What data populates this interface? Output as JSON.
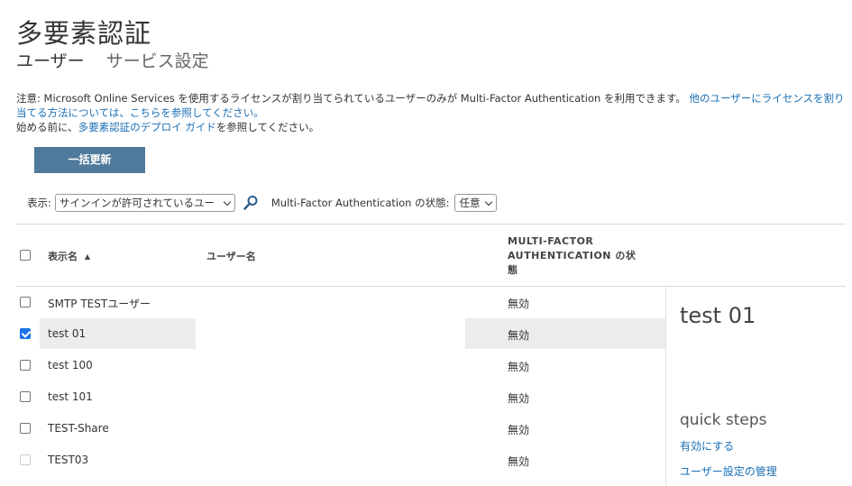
{
  "header": {
    "title": "多要素認証",
    "tabs": [
      {
        "label": "ユーザー",
        "active": true
      },
      {
        "label": "サービス設定",
        "active": false
      }
    ]
  },
  "notice": {
    "line1_text": "注意: Microsoft Online Services を使用するライセンスが割り当てられているユーザーのみが Multi-Factor Authentication を利用できます。",
    "line1_link": "他のユーザーにライセンスを割り当てる方法については、こちらを参照してください。",
    "line2_prefix": "始める前に、",
    "line2_link": "多要素認証のデプロイ ガイド",
    "line2_suffix": "を参照してください。"
  },
  "toolbar": {
    "bulk_update_label": "一括更新"
  },
  "filters": {
    "view_label": "表示:",
    "view_value": "サインインが許可されているユー",
    "mfa_state_label": "Multi-Factor Authentication の状態:",
    "mfa_state_value": "任意"
  },
  "table": {
    "headers": {
      "display_name": "表示名",
      "user_name": "ユーザー名",
      "mfa_status_line1": "MULTI-FACTOR",
      "mfa_status_line2": "AUTHENTICATION の状",
      "mfa_status_line3": "態"
    },
    "rows": [
      {
        "display_name": "SMTP TESTユーザー",
        "user_name": "",
        "mfa_status": "無効",
        "checked": false,
        "disabled": false
      },
      {
        "display_name": "test 01",
        "user_name": "",
        "mfa_status": "無効",
        "checked": true,
        "disabled": false
      },
      {
        "display_name": "test 100",
        "user_name": "",
        "mfa_status": "無効",
        "checked": false,
        "disabled": false
      },
      {
        "display_name": "test 101",
        "user_name": "",
        "mfa_status": "無効",
        "checked": false,
        "disabled": false
      },
      {
        "display_name": "TEST-Share",
        "user_name": "",
        "mfa_status": "無効",
        "checked": false,
        "disabled": false
      },
      {
        "display_name": "TEST03",
        "user_name": "",
        "mfa_status": "無効",
        "checked": false,
        "disabled": true
      }
    ]
  },
  "side_panel": {
    "title": "test 01",
    "quick_steps_title": "quick steps",
    "links": [
      "有効にする",
      "ユーザー設定の管理"
    ]
  },
  "colors": {
    "accent_button": "#4f7a9b",
    "link": "#1a6fb5",
    "checkbox_checked": "#1a73e8"
  }
}
